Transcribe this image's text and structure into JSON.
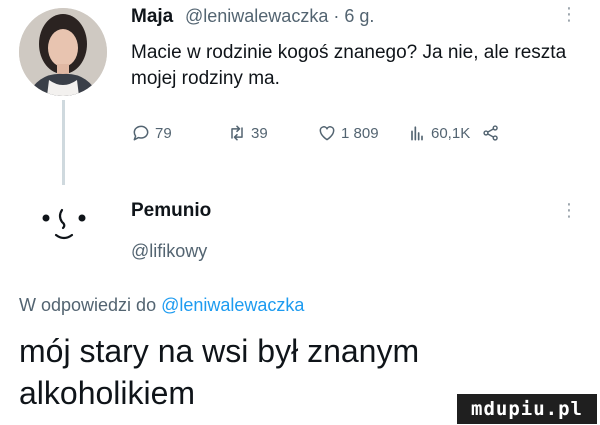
{
  "tweet1": {
    "name": "Maja",
    "handle_time": "@leniwalewaczka · 6 g.",
    "more_icon": "ellipsis-vertical-icon",
    "text": "Macie w rodzinie kogoś znanego? Ja nie, ale reszta mojej rodziny ma.",
    "actions": {
      "reply_count": "79",
      "retweet_count": "39",
      "like_count": "1 809",
      "views_count": "60,1K"
    }
  },
  "tweet2": {
    "name": "Pemunio",
    "handle": "@lifikowy",
    "reply_prefix": "W odpowiedzi do ",
    "reply_mention": "@leniwalewaczka",
    "text": "mój stary na wsi był znanym alkoholikiem"
  },
  "watermark": "mdupiu.pl",
  "colors": {
    "text": "#0f1419",
    "muted": "#536471",
    "link": "#1d9bf0",
    "thread_line": "#cfd9de"
  }
}
